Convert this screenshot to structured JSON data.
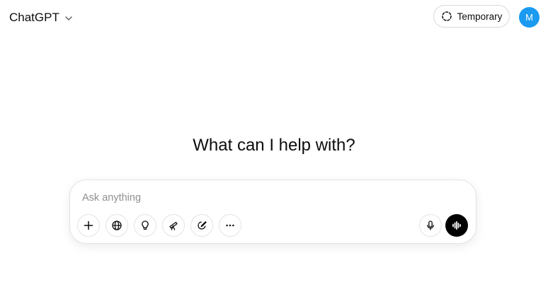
{
  "header": {
    "model_name": "ChatGPT",
    "model_chevron_icon": "chevron-down-icon",
    "temporary_label": "Temporary",
    "temporary_icon": "dashed-circle-icon",
    "avatar_initial": "M",
    "avatar_color": "#1a9af0"
  },
  "main": {
    "headline": "What can I help with?"
  },
  "composer": {
    "placeholder": "Ask anything",
    "value": "",
    "tools": [
      {
        "name": "add-attachment-button",
        "icon": "plus-icon"
      },
      {
        "name": "web-search-button",
        "icon": "globe-icon"
      },
      {
        "name": "reason-button",
        "icon": "lightbulb-icon"
      },
      {
        "name": "deep-research-button",
        "icon": "telescope-icon"
      },
      {
        "name": "create-image-button",
        "icon": "paintbrush-icon"
      },
      {
        "name": "more-tools-button",
        "icon": "ellipsis-icon"
      }
    ],
    "dictate_icon": "microphone-icon",
    "voice_icon": "voice-waveform-icon"
  }
}
